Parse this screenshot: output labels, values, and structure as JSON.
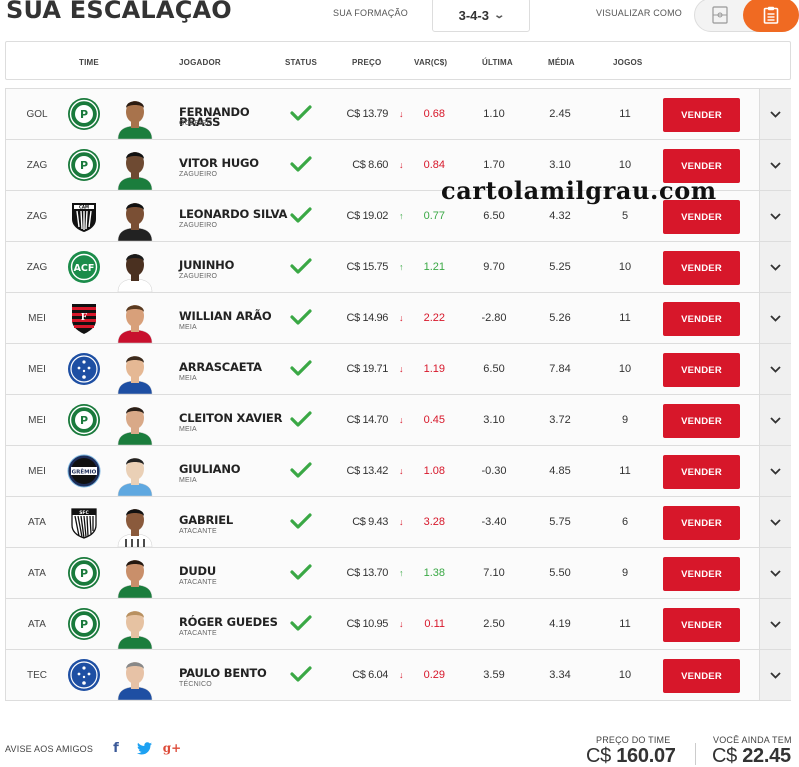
{
  "page": {
    "title": "SUA ESCALAÇÃO"
  },
  "formation": {
    "label": "SUA FORMAÇÃO",
    "value": "3-4-3"
  },
  "view": {
    "label": "VISUALIZAR COMO",
    "active": "list"
  },
  "columns": [
    "TIME",
    "JOGADOR",
    "STATUS",
    "PREÇO",
    "VAR(C$)",
    "ÚLTIMA",
    "MÉDIA",
    "JOGOS"
  ],
  "sell_label": "VENDER",
  "currency": "C$",
  "players": [
    {
      "pos": "GOL",
      "club": "palmeiras",
      "name": "FERNANDO PRASS",
      "role": "GOLEIRO",
      "price": "C$ 13.79",
      "trend": "down",
      "var": "0.68",
      "ultima": "1.10",
      "media": "2.45",
      "jogos": "11",
      "status": "confirmed"
    },
    {
      "pos": "ZAG",
      "club": "palmeiras",
      "name": "VITOR HUGO",
      "role": "ZAGUEIRO",
      "price": "C$ 8.60",
      "trend": "down",
      "var": "0.84",
      "ultima": "1.70",
      "media": "3.10",
      "jogos": "10",
      "status": "confirmed"
    },
    {
      "pos": "ZAG",
      "club": "atletico-mg",
      "name": "LEONARDO SILVA",
      "role": "ZAGUEIRO",
      "price": "C$ 19.02",
      "trend": "up",
      "var": "0.77",
      "ultima": "6.50",
      "media": "4.32",
      "jogos": "5",
      "status": "confirmed"
    },
    {
      "pos": "ZAG",
      "club": "chapecoense",
      "name": "JUNINHO",
      "role": "ZAGUEIRO",
      "price": "C$ 15.75",
      "trend": "up",
      "var": "1.21",
      "ultima": "9.70",
      "media": "5.25",
      "jogos": "10",
      "status": "confirmed"
    },
    {
      "pos": "MEI",
      "club": "flamengo",
      "name": "WILLIAN ARÃO",
      "role": "MEIA",
      "price": "C$ 14.96",
      "trend": "down",
      "var": "2.22",
      "ultima": "-2.80",
      "media": "5.26",
      "jogos": "11",
      "status": "confirmed"
    },
    {
      "pos": "MEI",
      "club": "cruzeiro",
      "name": "ARRASCAETA",
      "role": "MEIA",
      "price": "C$ 19.71",
      "trend": "down",
      "var": "1.19",
      "ultima": "6.50",
      "media": "7.84",
      "jogos": "10",
      "status": "confirmed"
    },
    {
      "pos": "MEI",
      "club": "palmeiras",
      "name": "CLEITON XAVIER",
      "role": "MEIA",
      "price": "C$ 14.70",
      "trend": "down",
      "var": "0.45",
      "ultima": "3.10",
      "media": "3.72",
      "jogos": "9",
      "status": "confirmed"
    },
    {
      "pos": "MEI",
      "club": "gremio",
      "name": "GIULIANO",
      "role": "MEIA",
      "price": "C$ 13.42",
      "trend": "down",
      "var": "1.08",
      "ultima": "-0.30",
      "media": "4.85",
      "jogos": "11",
      "status": "confirmed"
    },
    {
      "pos": "ATA",
      "club": "santos",
      "name": "GABRIEL",
      "role": "ATACANTE",
      "price": "C$ 9.43",
      "trend": "down",
      "var": "3.28",
      "ultima": "-3.40",
      "media": "5.75",
      "jogos": "6",
      "status": "confirmed"
    },
    {
      "pos": "ATA",
      "club": "palmeiras",
      "name": "DUDU",
      "role": "ATACANTE",
      "price": "C$ 13.70",
      "trend": "up",
      "var": "1.38",
      "ultima": "7.10",
      "media": "5.50",
      "jogos": "9",
      "status": "confirmed"
    },
    {
      "pos": "ATA",
      "club": "palmeiras",
      "name": "RÓGER GUEDES",
      "role": "ATACANTE",
      "price": "C$ 10.95",
      "trend": "down",
      "var": "0.11",
      "ultima": "2.50",
      "media": "4.19",
      "jogos": "11",
      "status": "confirmed"
    },
    {
      "pos": "TEC",
      "club": "cruzeiro",
      "name": "PAULO BENTO",
      "role": "TÉCNICO",
      "price": "C$ 6.04",
      "trend": "down",
      "var": "0.29",
      "ultima": "3.59",
      "media": "3.34",
      "jogos": "10",
      "status": "confirmed"
    }
  ],
  "watermark": "cartolamilgrau.com",
  "footer": {
    "share_label": "AVISE AOS AMIGOS",
    "share": [
      {
        "icon": "facebook-icon",
        "glyph": "f"
      },
      {
        "icon": "twitter-icon",
        "glyph": ""
      },
      {
        "icon": "google-plus-icon",
        "glyph": "g+"
      }
    ],
    "team_price_label": "PREÇO DO TIME",
    "team_price_currency": "C$",
    "team_price_value": "160.07",
    "remaining_label": "VOCÊ AINDA TEM",
    "remaining_currency": "C$",
    "remaining_value": "22.45"
  },
  "colors": {
    "accent": "#f06a22",
    "sell": "#d7172a",
    "up": "#3aa845",
    "down": "#d7172a",
    "check": "#3aa845"
  }
}
